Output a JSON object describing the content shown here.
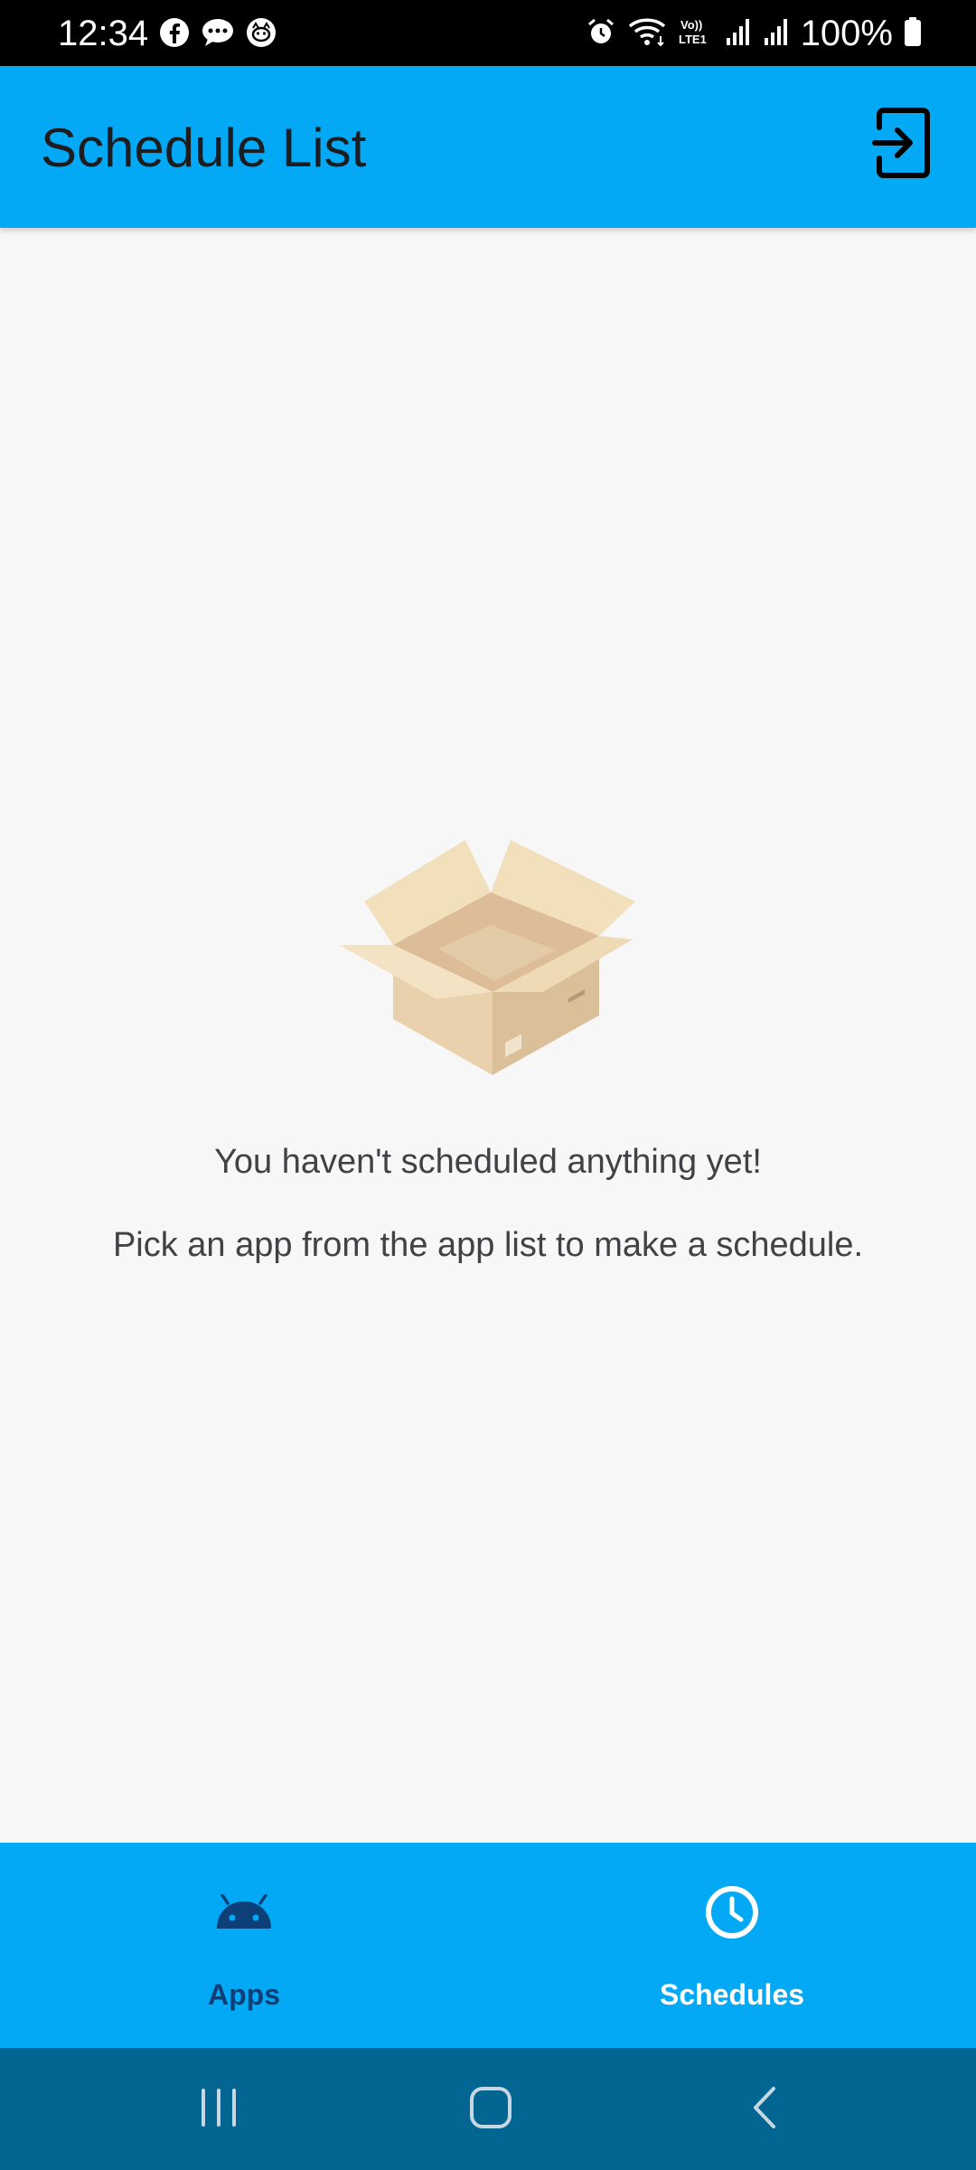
{
  "status_bar": {
    "time": "12:34",
    "battery_percent": "100%",
    "left_icons": [
      "facebook-icon",
      "messenger-icon",
      "cat-app-icon"
    ],
    "right_icons": [
      "alarm-icon",
      "wifi-icon",
      "volte-lte-icon",
      "signal-1-icon",
      "signal-2-icon",
      "battery-icon"
    ]
  },
  "app_bar": {
    "title": "Schedule List",
    "action_icon": "logout-icon",
    "background": "#03a9f4"
  },
  "empty_state": {
    "illustration": "open-box-icon",
    "title": "You haven't scheduled anything yet!",
    "subtitle": "Pick an app from the app list to make a schedule."
  },
  "bottom_nav": {
    "background": "#03a9f4",
    "items": [
      {
        "label": "Apps",
        "icon": "android-icon",
        "active": false
      },
      {
        "label": "Schedules",
        "icon": "clock-icon",
        "active": true
      }
    ],
    "active_color": "#ffffff",
    "inactive_color": "#0d3f79"
  },
  "system_nav": {
    "background": "#036592",
    "buttons": [
      "recents-icon",
      "home-icon",
      "back-icon"
    ]
  }
}
